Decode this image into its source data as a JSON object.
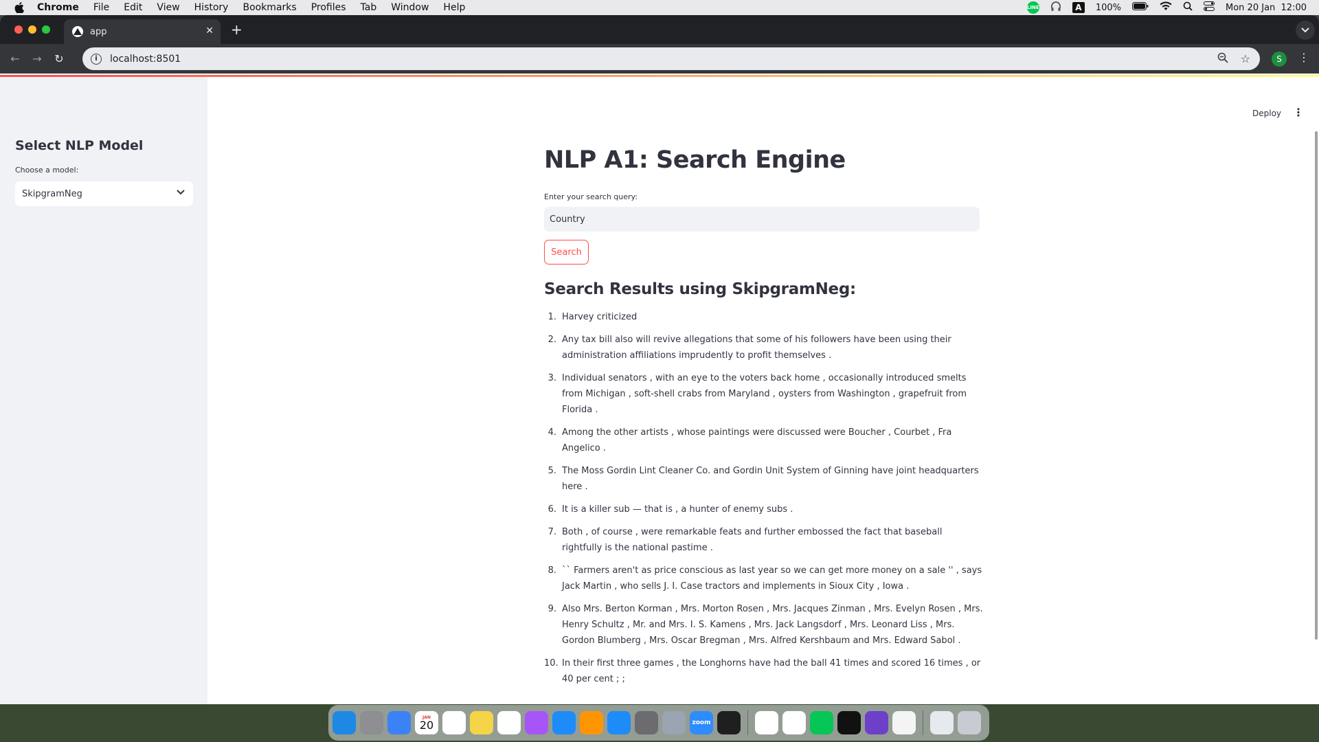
{
  "menubar": {
    "app_name": "Chrome",
    "items": [
      "File",
      "Edit",
      "View",
      "History",
      "Bookmarks",
      "Profiles",
      "Tab",
      "Window",
      "Help"
    ],
    "battery": "100%",
    "datetime": "Mon 20 Jan  12:00",
    "status_line_badge": "LINE",
    "input_source": "A"
  },
  "browser": {
    "tab_title": "app",
    "url": "localhost:8501",
    "profile_initial": "S"
  },
  "sidebar": {
    "title": "Select NLP Model",
    "select_label": "Choose a model:",
    "selected_model": "SkipgramNeg"
  },
  "header": {
    "deploy_label": "Deploy"
  },
  "main": {
    "title": "NLP A1: Search Engine",
    "query_label": "Enter your search query:",
    "query_value": "Country",
    "search_button": "Search",
    "results_heading": "Search Results using SkipgramNeg:",
    "results": [
      {
        "num": "1.",
        "text": "Harvey criticized"
      },
      {
        "num": "2.",
        "text": "Any tax bill also will revive allegations that some of his followers have been using their administration affiliations imprudently to profit themselves ."
      },
      {
        "num": "3.",
        "text": "Individual senators , with an eye to the voters back home , occasionally introduced smelts from Michigan , soft-shell crabs from Maryland , oysters from Washington , grapefruit from Florida ."
      },
      {
        "num": "4.",
        "text": "Among the other artists , whose paintings were discussed were Boucher , Courbet , Fra Angelico ."
      },
      {
        "num": "5.",
        "text": "The Moss Gordin Lint Cleaner Co. and Gordin Unit System of Ginning have joint headquarters here ."
      },
      {
        "num": "6.",
        "text": "It is a killer sub — that is , a hunter of enemy subs ."
      },
      {
        "num": "7.",
        "text": "Both , of course , were remarkable feats and further embossed the fact that baseball rightfully is the national pastime ."
      },
      {
        "num": "8.",
        "text": "`` Farmers aren't as price conscious as last year so we can get more money on a sale '' , says Jack Martin , who sells J. I. Case tractors and implements in Sioux City , Iowa ."
      },
      {
        "num": "9.",
        "text": "Also Mrs. Berton Korman , Mrs. Morton Rosen , Mrs. Jacques Zinman , Mrs. Evelyn Rosen , Mrs. Henry Schultz , Mr. and Mrs. I. S. Kamens , Mrs. Jack Langsdorf , Mrs. Leonard Liss , Mrs. Gordon Blumberg , Mrs. Oscar Bregman , Mrs. Alfred Kershbaum and Mrs. Edward Sabol ."
      },
      {
        "num": "10.",
        "text": "In their first three games , the Longhorns have had the ball 41 times and scored 16 times , or 40 per cent ; ;"
      }
    ]
  },
  "dock": {
    "calendar_month": "JAN",
    "calendar_day": "20",
    "zoom_label": "zoom",
    "apps": [
      {
        "name": "finder-icon",
        "color": "#1e88e5"
      },
      {
        "name": "launchpad-icon",
        "color": "#8e8e93"
      },
      {
        "name": "mail-icon",
        "color": "#3b82f6"
      },
      {
        "name": "calendar-icon",
        "color": "#ffffff"
      },
      {
        "name": "reminders-icon",
        "color": "#ffffff"
      },
      {
        "name": "notes-icon",
        "color": "#f5d547"
      },
      {
        "name": "freeform-icon",
        "color": "#ffffff"
      },
      {
        "name": "messenger-icon",
        "color": "#a855f7"
      },
      {
        "name": "keynote-icon",
        "color": "#1d8cf8"
      },
      {
        "name": "pages-icon",
        "color": "#ff9500"
      },
      {
        "name": "app-store-icon",
        "color": "#1d8cf8"
      },
      {
        "name": "system-settings-icon",
        "color": "#6b6b70"
      },
      {
        "name": "preview-icon",
        "color": "#9aa4b2"
      },
      {
        "name": "zoom-icon",
        "color": "#2d8cff"
      },
      {
        "name": "activity-monitor-icon",
        "color": "#1f1f1f"
      },
      {
        "name": "chrome-icon",
        "color": "#ffffff"
      },
      {
        "name": "vscode-icon",
        "color": "#ffffff"
      },
      {
        "name": "line-icon",
        "color": "#06c755"
      },
      {
        "name": "terminal-icon",
        "color": "#111111"
      },
      {
        "name": "github-desktop-icon",
        "color": "#6e40c9"
      },
      {
        "name": "textedit-icon",
        "color": "#f4f4f4"
      },
      {
        "name": "documents-folder-icon",
        "color": "#e6e9ee"
      },
      {
        "name": "trash-icon",
        "color": "#c8ccd2"
      }
    ]
  }
}
